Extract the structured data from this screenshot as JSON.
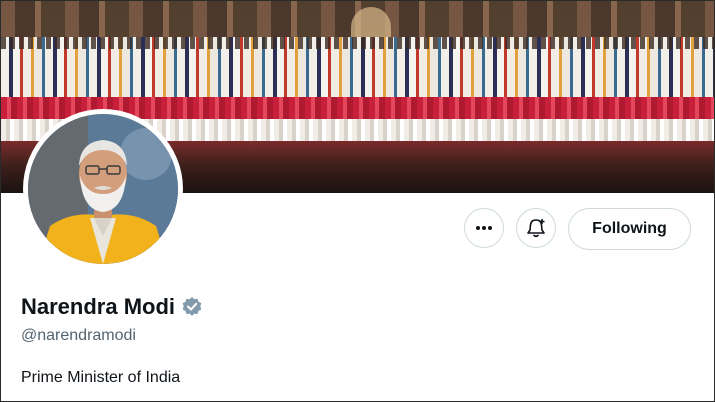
{
  "profile": {
    "display_name": "Narendra Modi",
    "handle": "@narendramodi",
    "bio": "Prime Minister of India",
    "verified_badge": "grey-verified-icon"
  },
  "actions": {
    "more_icon": "more-icon",
    "notify_icon": "add-notification-bell-icon",
    "follow_label": "Following"
  },
  "colors": {
    "text_primary": "#0f1419",
    "text_secondary": "#536471",
    "border": "#cfd9de",
    "verified_grey": "#829aab",
    "jacket": "#f2b21b"
  }
}
